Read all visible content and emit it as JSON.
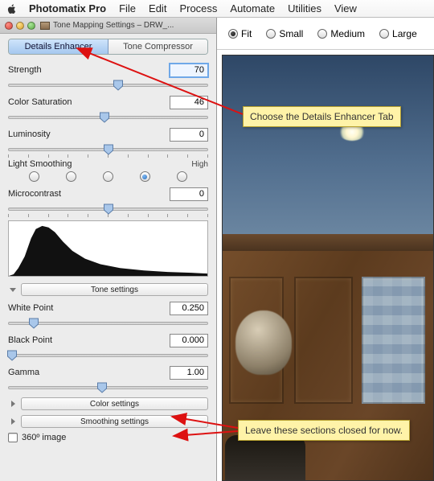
{
  "menubar": {
    "app": "Photomatix Pro",
    "items": [
      "File",
      "Edit",
      "Process",
      "Automate",
      "Utilities",
      "View"
    ]
  },
  "panel": {
    "title": "Tone Mapping Settings – DRW_...",
    "tabs": {
      "details": "Details Enhancer",
      "compressor": "Tone Compressor"
    },
    "sliders": {
      "strength": {
        "label": "Strength",
        "value": "70",
        "pos": 55
      },
      "saturation": {
        "label": "Color Saturation",
        "value": "46",
        "pos": 48
      },
      "luminosity": {
        "label": "Luminosity",
        "value": "0",
        "pos": 50
      },
      "micro": {
        "label": "Microcontrast",
        "value": "0",
        "pos": 50
      },
      "whitepoint": {
        "label": "White Point",
        "value": "0.250",
        "pos": 13
      },
      "blackpoint": {
        "label": "Black Point",
        "value": "0.000",
        "pos": 2
      },
      "gamma": {
        "label": "Gamma",
        "value": "1.00",
        "pos": 47
      }
    },
    "light_smoothing": {
      "label": "Light Smoothing",
      "high": "High",
      "selected": 3
    },
    "sections": {
      "tone": "Tone settings",
      "color": "Color settings",
      "smoothing": "Smoothing settings"
    },
    "checkbox": "360º image"
  },
  "preview": {
    "sizes": {
      "fit": "Fit",
      "small": "Small",
      "medium": "Medium",
      "large": "Large"
    }
  },
  "callouts": {
    "c1": "Choose the Details Enhancer Tab",
    "c2": "Leave these sections closed for now."
  }
}
